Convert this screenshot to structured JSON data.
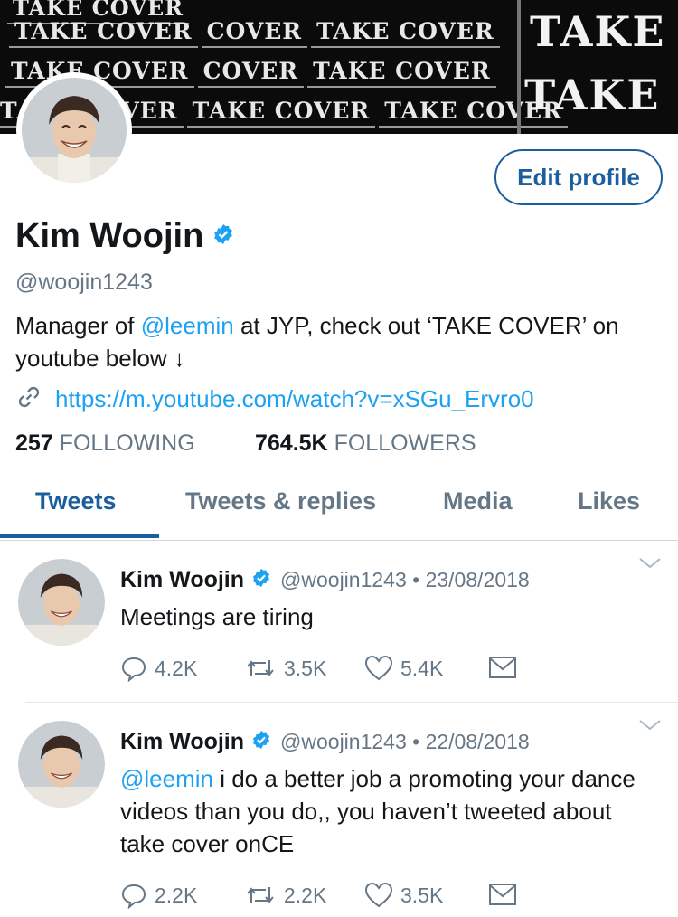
{
  "banner": {
    "repeat_text": "TAKE COVER",
    "partial_text": "COVER",
    "big_text": "TAKE C"
  },
  "profile": {
    "name": "Kim Woojin",
    "handle": "@woojin1243",
    "edit_button": "Edit profile",
    "bio_prefix": "Manager of ",
    "bio_mention": "@leemin",
    "bio_suffix": " at JYP, check out ‘TAKE COVER’ on youtube below ↓",
    "link": "https://m.youtube.com/watch?v=xSGu_Ervro0",
    "following_count": "257",
    "following_label": "FOLLOWING",
    "followers_count": "764.5K",
    "followers_label": "FOLLOWERS"
  },
  "tabs": [
    {
      "label": "Tweets"
    },
    {
      "label": "Tweets & replies"
    },
    {
      "label": "Media"
    },
    {
      "label": "Likes"
    }
  ],
  "tweets": [
    {
      "name": "Kim Woojin",
      "meta": "@woojin1243 • 23/08/2018",
      "mention": "",
      "text": "Meetings are tiring",
      "replies": "4.2K",
      "retweets": "3.5K",
      "likes": "5.4K"
    },
    {
      "name": "Kim Woojin",
      "meta": "@woojin1243 • 22/08/2018",
      "mention": "@leemin",
      "text": " i do a better job a promoting your dance videos than you do,, you haven’t tweeted about take cover onCE",
      "replies": "2.2K",
      "retweets": "2.2K",
      "likes": "3.5K"
    }
  ],
  "colors": {
    "accent": "#1da1f2",
    "tab_active": "#1b5e9e",
    "muted": "#657786",
    "text": "#14171a"
  }
}
